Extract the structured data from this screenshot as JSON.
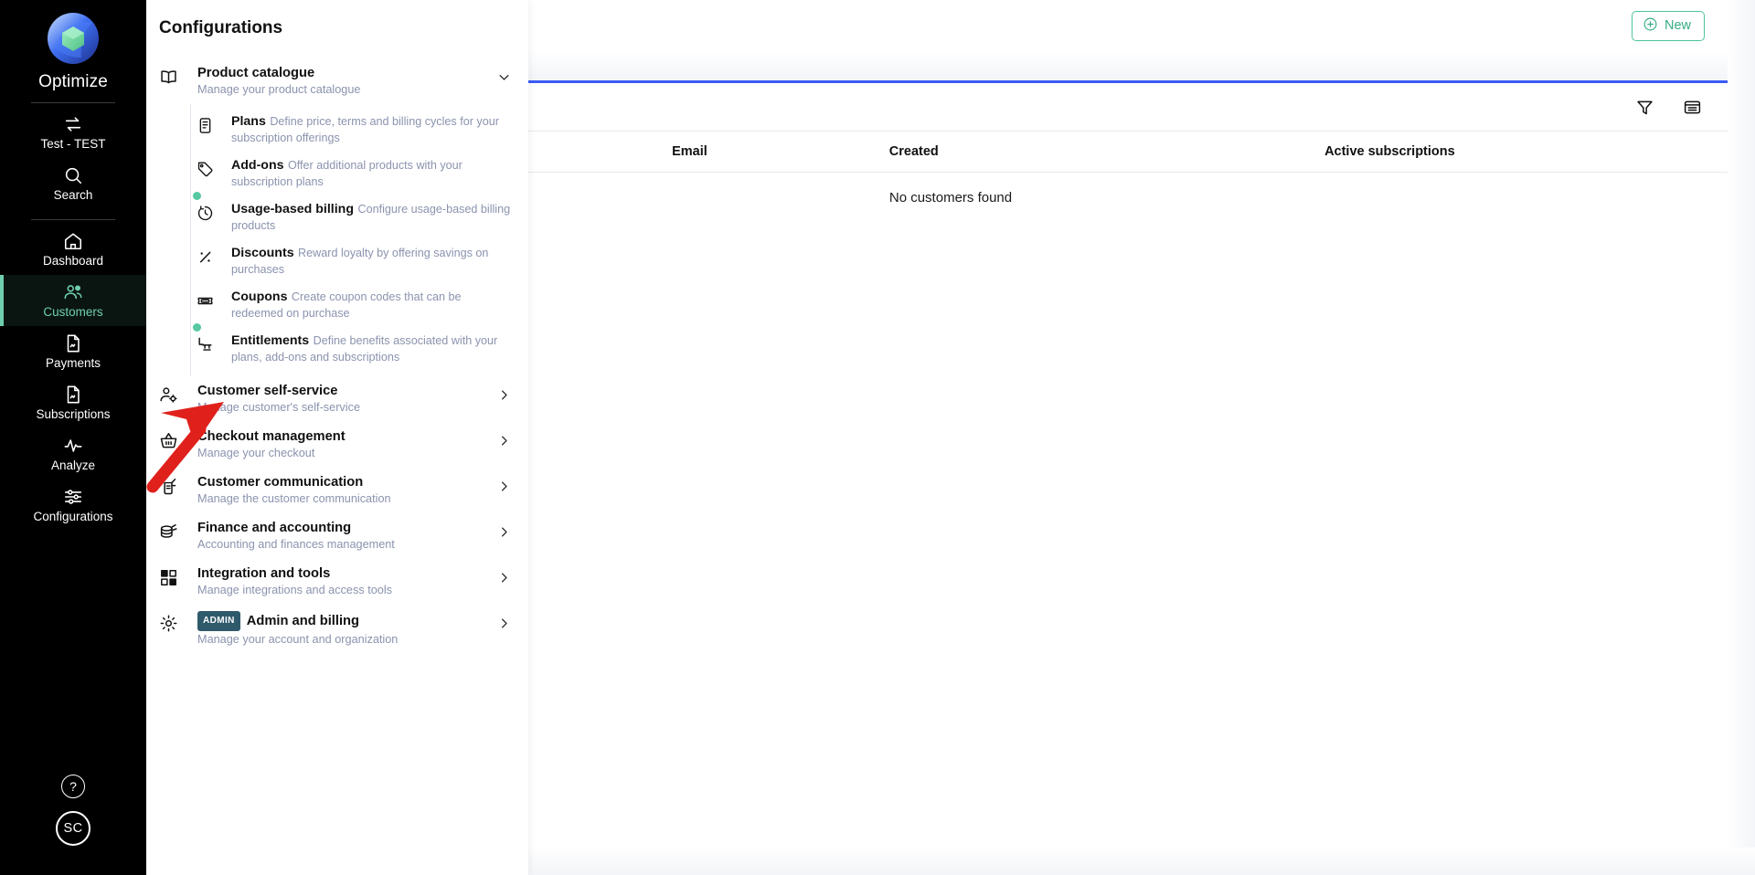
{
  "rail": {
    "brand": "Optimize",
    "items": [
      {
        "label": "Test - TEST",
        "icon": "switch-icon",
        "active": false
      },
      {
        "label": "Search",
        "icon": "search-icon",
        "active": false
      },
      {
        "label": "Dashboard",
        "icon": "home-icon",
        "active": false
      },
      {
        "label": "Customers",
        "icon": "customers-icon",
        "active": true
      },
      {
        "label": "Payments",
        "icon": "payments-icon",
        "active": false
      },
      {
        "label": "Subscriptions",
        "icon": "subscriptions-icon",
        "active": false
      },
      {
        "label": "Analyze",
        "icon": "analyze-icon",
        "active": false
      },
      {
        "label": "Configurations",
        "icon": "configurations-icon",
        "active": false
      }
    ],
    "help_label": "?",
    "avatar_initials": "SC"
  },
  "topbar": {
    "new_label": "New"
  },
  "toolbar": {
    "filter_icon": "filter-icon",
    "card_view_icon": "card-view-icon"
  },
  "table": {
    "headers": [
      "",
      "Email",
      "Created",
      "Active subscriptions"
    ],
    "empty_message": "No customers found",
    "rows": []
  },
  "panel": {
    "title": "Configurations",
    "groups": [
      {
        "title": "Product catalogue",
        "subtitle": "Manage your product catalogue",
        "icon": "book-icon",
        "expanded": true,
        "chevron": "chevron-down-icon",
        "badge": "",
        "children": [
          {
            "title": "Plans",
            "subtitle": "Define price, terms and billing cycles for your subscription offerings",
            "icon": "plans-icon",
            "new_dot": false
          },
          {
            "title": "Add-ons",
            "subtitle": "Offer additional products with your subscription plans",
            "icon": "tag-icon",
            "new_dot": false
          },
          {
            "title": "Usage-based billing",
            "subtitle": "Configure usage-based billing products",
            "icon": "meter-icon",
            "new_dot": true
          },
          {
            "title": "Discounts",
            "subtitle": "Reward loyalty by offering savings on purchases",
            "icon": "percent-icon",
            "new_dot": false
          },
          {
            "title": "Coupons",
            "subtitle": "Create coupon codes that can be redeemed on purchase",
            "icon": "ticket-icon",
            "new_dot": false
          },
          {
            "title": "Entitlements",
            "subtitle": "Define benefits associated with your plans, add-ons and subscriptions",
            "icon": "entitlements-icon",
            "new_dot": true
          }
        ]
      },
      {
        "title": "Customer self-service",
        "subtitle": "Manage customer's self-service",
        "icon": "user-gear-icon",
        "expanded": false,
        "chevron": "chevron-right-icon",
        "badge": "",
        "children": []
      },
      {
        "title": "Checkout management",
        "subtitle": "Manage your checkout",
        "icon": "basket-icon",
        "expanded": false,
        "chevron": "chevron-right-icon",
        "badge": "",
        "children": []
      },
      {
        "title": "Customer communication",
        "subtitle": "Manage the customer communication",
        "icon": "megaphone-icon",
        "expanded": false,
        "chevron": "chevron-right-icon",
        "badge": "",
        "children": []
      },
      {
        "title": "Finance and accounting",
        "subtitle": "Accounting and finances management",
        "icon": "coins-icon",
        "expanded": false,
        "chevron": "chevron-right-icon",
        "badge": "",
        "children": []
      },
      {
        "title": "Integration and tools",
        "subtitle": "Manage integrations and access tools",
        "icon": "puzzle-icon",
        "expanded": false,
        "chevron": "chevron-right-icon",
        "badge": "",
        "children": []
      },
      {
        "title": "Admin and billing",
        "subtitle": "Manage your account and organization",
        "icon": "gear-icon",
        "expanded": false,
        "chevron": "chevron-right-icon",
        "badge": "ADMIN",
        "children": []
      }
    ]
  },
  "annotation": {
    "type": "arrow",
    "color": "#e0201b",
    "points_to": "Entitlements"
  },
  "colors": {
    "rail_background": "#000000",
    "accent_green": "#6ecfae",
    "new_button_border": "#4ec39a",
    "new_button_text": "#34ab84",
    "progress_bar": "#3b5bf5",
    "new_dot": "#56c9a2",
    "admin_badge": "#2f5a6b",
    "annotation_red": "#e0201b",
    "subtitle_text": "#8b93ae"
  }
}
